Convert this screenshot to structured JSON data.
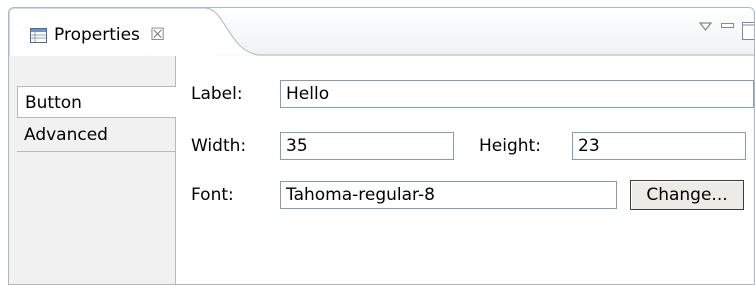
{
  "view": {
    "tab_title": "Properties",
    "tab_icon": "properties-table-icon",
    "close_glyph": "☒"
  },
  "toolbar": {
    "view_menu_icon": "view-menu-triangle-icon",
    "minimize_icon": "minimize-icon",
    "maximize_icon": "maximize-icon"
  },
  "tabs": [
    {
      "label": "Button",
      "selected": true
    },
    {
      "label": "Advanced",
      "selected": false
    }
  ],
  "form": {
    "label_label": "Label:",
    "label_value": "Hello",
    "width_label": "Width:",
    "width_value": "35",
    "height_label": "Height:",
    "height_value": "23",
    "font_label": "Font:",
    "font_value": "Tahoma-regular-8",
    "change_button": "Change..."
  },
  "colors": {
    "field_border": "#7f9db9",
    "tab_border": "#a9b8c4",
    "sidebar_bg": "#f1f1f1"
  }
}
